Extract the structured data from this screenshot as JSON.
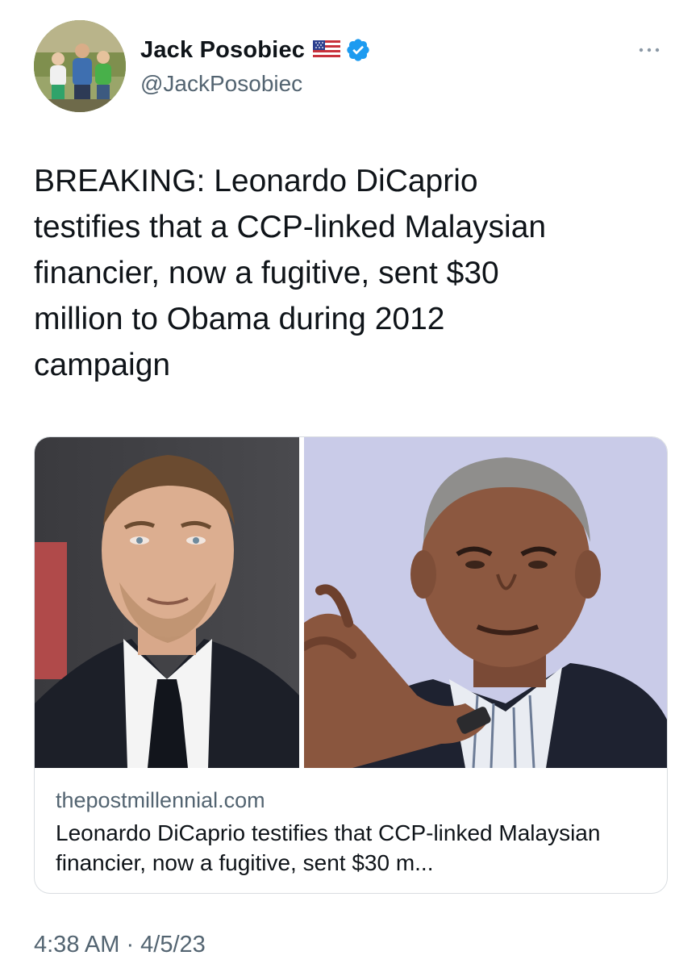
{
  "author": {
    "display_name": "Jack Posobiec",
    "handle": "@JackPosobiec",
    "flag_icon": "us-flag-icon",
    "verified_icon": "verified-badge-icon",
    "verified_color": "#1d9bf0"
  },
  "menu": {
    "more_icon": "more-options-icon"
  },
  "tweet": {
    "text": "BREAKING: Leonardo DiCaprio\ntestifies that a CCP-linked Malaysian\nfinancier, now a fugitive, sent $30\nmillion to Obama during 2012\ncampaign"
  },
  "link_card": {
    "domain": "thepostmillennial.com",
    "title": "Leonardo DiCaprio testifies that CCP-linked Malaysian financier, now a fugitive, sent $30 m..."
  },
  "meta": {
    "timestamp": "4:38 AM · 4/5/23"
  },
  "colors": {
    "text_primary": "#0f1419",
    "text_secondary": "#536471",
    "border": "#d9dde1"
  }
}
